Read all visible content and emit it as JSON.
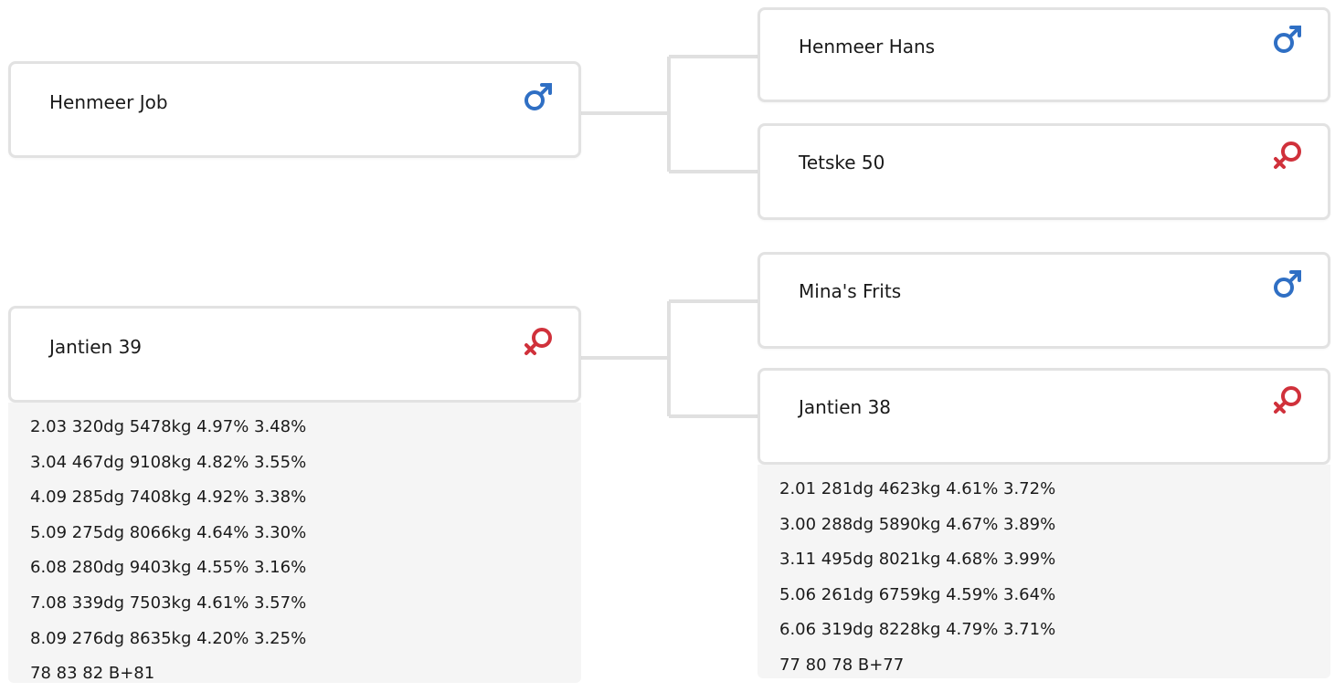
{
  "colors": {
    "male": "#2f6fc4",
    "female": "#d0313b",
    "card_border": "#e2e2e2",
    "connector": "#e0e0e0",
    "stats_bg": "#f5f5f5"
  },
  "animals": {
    "sire": {
      "name": "Henmeer Job",
      "sex": "male",
      "icon": "male-icon"
    },
    "dam": {
      "name": "Jantien 39",
      "sex": "female",
      "icon": "female-icon",
      "stats": [
        "2.03 320dg 5478kg 4.97% 3.48%",
        "3.04 467dg 9108kg 4.82% 3.55%",
        "4.09 285dg 7408kg 4.92% 3.38%",
        "5.09 275dg 8066kg 4.64% 3.30%",
        "6.08 280dg 9403kg 4.55% 3.16%",
        "7.08 339dg 7503kg 4.61% 3.57%",
        "8.09 276dg 8635kg 4.20% 3.25%",
        "78 83 82 B+81"
      ]
    },
    "sire_sire": {
      "name": "Henmeer Hans",
      "sex": "male",
      "icon": "male-icon"
    },
    "sire_dam": {
      "name": "Tetske 50",
      "sex": "female",
      "icon": "female-icon"
    },
    "dam_sire": {
      "name": "Mina's Frits",
      "sex": "male",
      "icon": "male-icon"
    },
    "dam_dam": {
      "name": "Jantien 38",
      "sex": "female",
      "icon": "female-icon",
      "stats": [
        "2.01 281dg 4623kg 4.61% 3.72%",
        "3.00 288dg 5890kg 4.67% 3.89%",
        "3.11 495dg 8021kg 4.68% 3.99%",
        "5.06 261dg 6759kg 4.59% 3.64%",
        "6.06 319dg 8228kg 4.79% 3.71%",
        "77 80 78 B+77"
      ]
    }
  }
}
